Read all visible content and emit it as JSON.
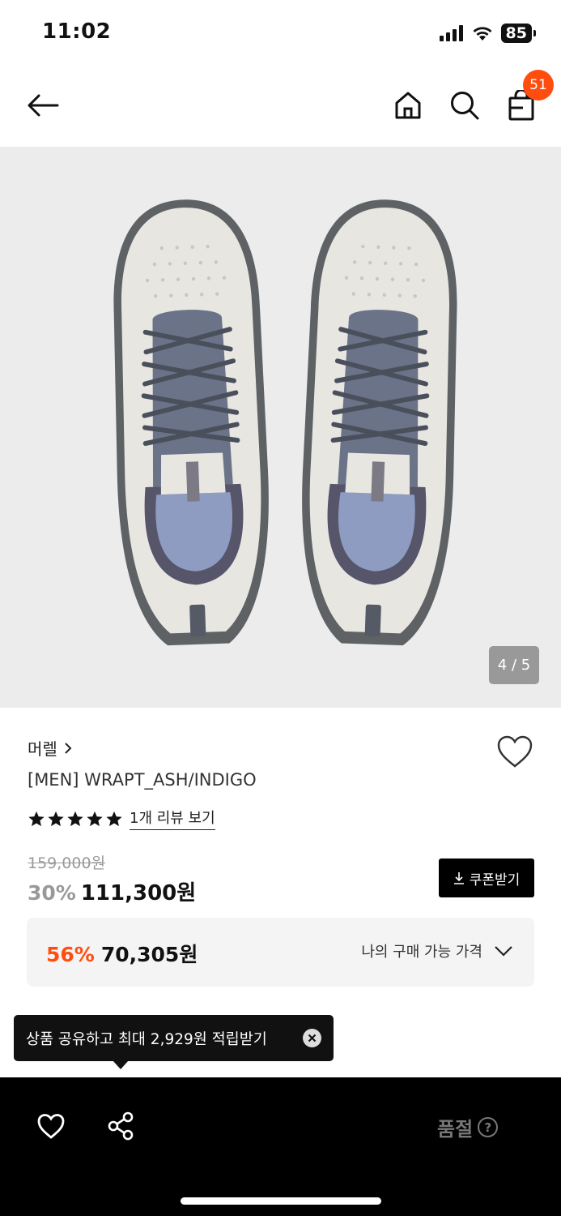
{
  "status_bar": {
    "time": "11:02",
    "battery": "85",
    "icons": [
      "cellular-signal-icon",
      "wifi-icon",
      "battery-icon"
    ]
  },
  "nav": {
    "back_icon": "arrow-left-icon",
    "home_icon": "home-icon",
    "search_icon": "search-icon",
    "cart_icon": "shopping-bag-icon",
    "cart_count": "51"
  },
  "gallery": {
    "image_subject": "light gray barefoot running shoes with indigo laces, top view",
    "counter": "4 / 5"
  },
  "product": {
    "brand": "머렐",
    "name": "[MEN] WRAPT_ASH/INDIGO",
    "rating_stars": 5,
    "review_link": "1개 리뷰 보기",
    "original_price": "159,000원",
    "discount_rate": "30%",
    "sale_price": "111,300원",
    "coupon_button": "쿠폰받기"
  },
  "my_price": {
    "discount": "56%",
    "amount": "70,305원",
    "label": "나의 구매 가능 가격"
  },
  "tooltip": {
    "text": "상품 공유하고 최대 2,929원 적립받기"
  },
  "bottom_bar": {
    "wishlist_icon": "heart-icon",
    "share_icon": "share-icon",
    "soldout_label": "품절",
    "help_icon": "question-circle-icon"
  },
  "colors": {
    "accent": "#ff4d0f",
    "bottom_bar": "#000000",
    "gallery_bg": "#ececec"
  }
}
